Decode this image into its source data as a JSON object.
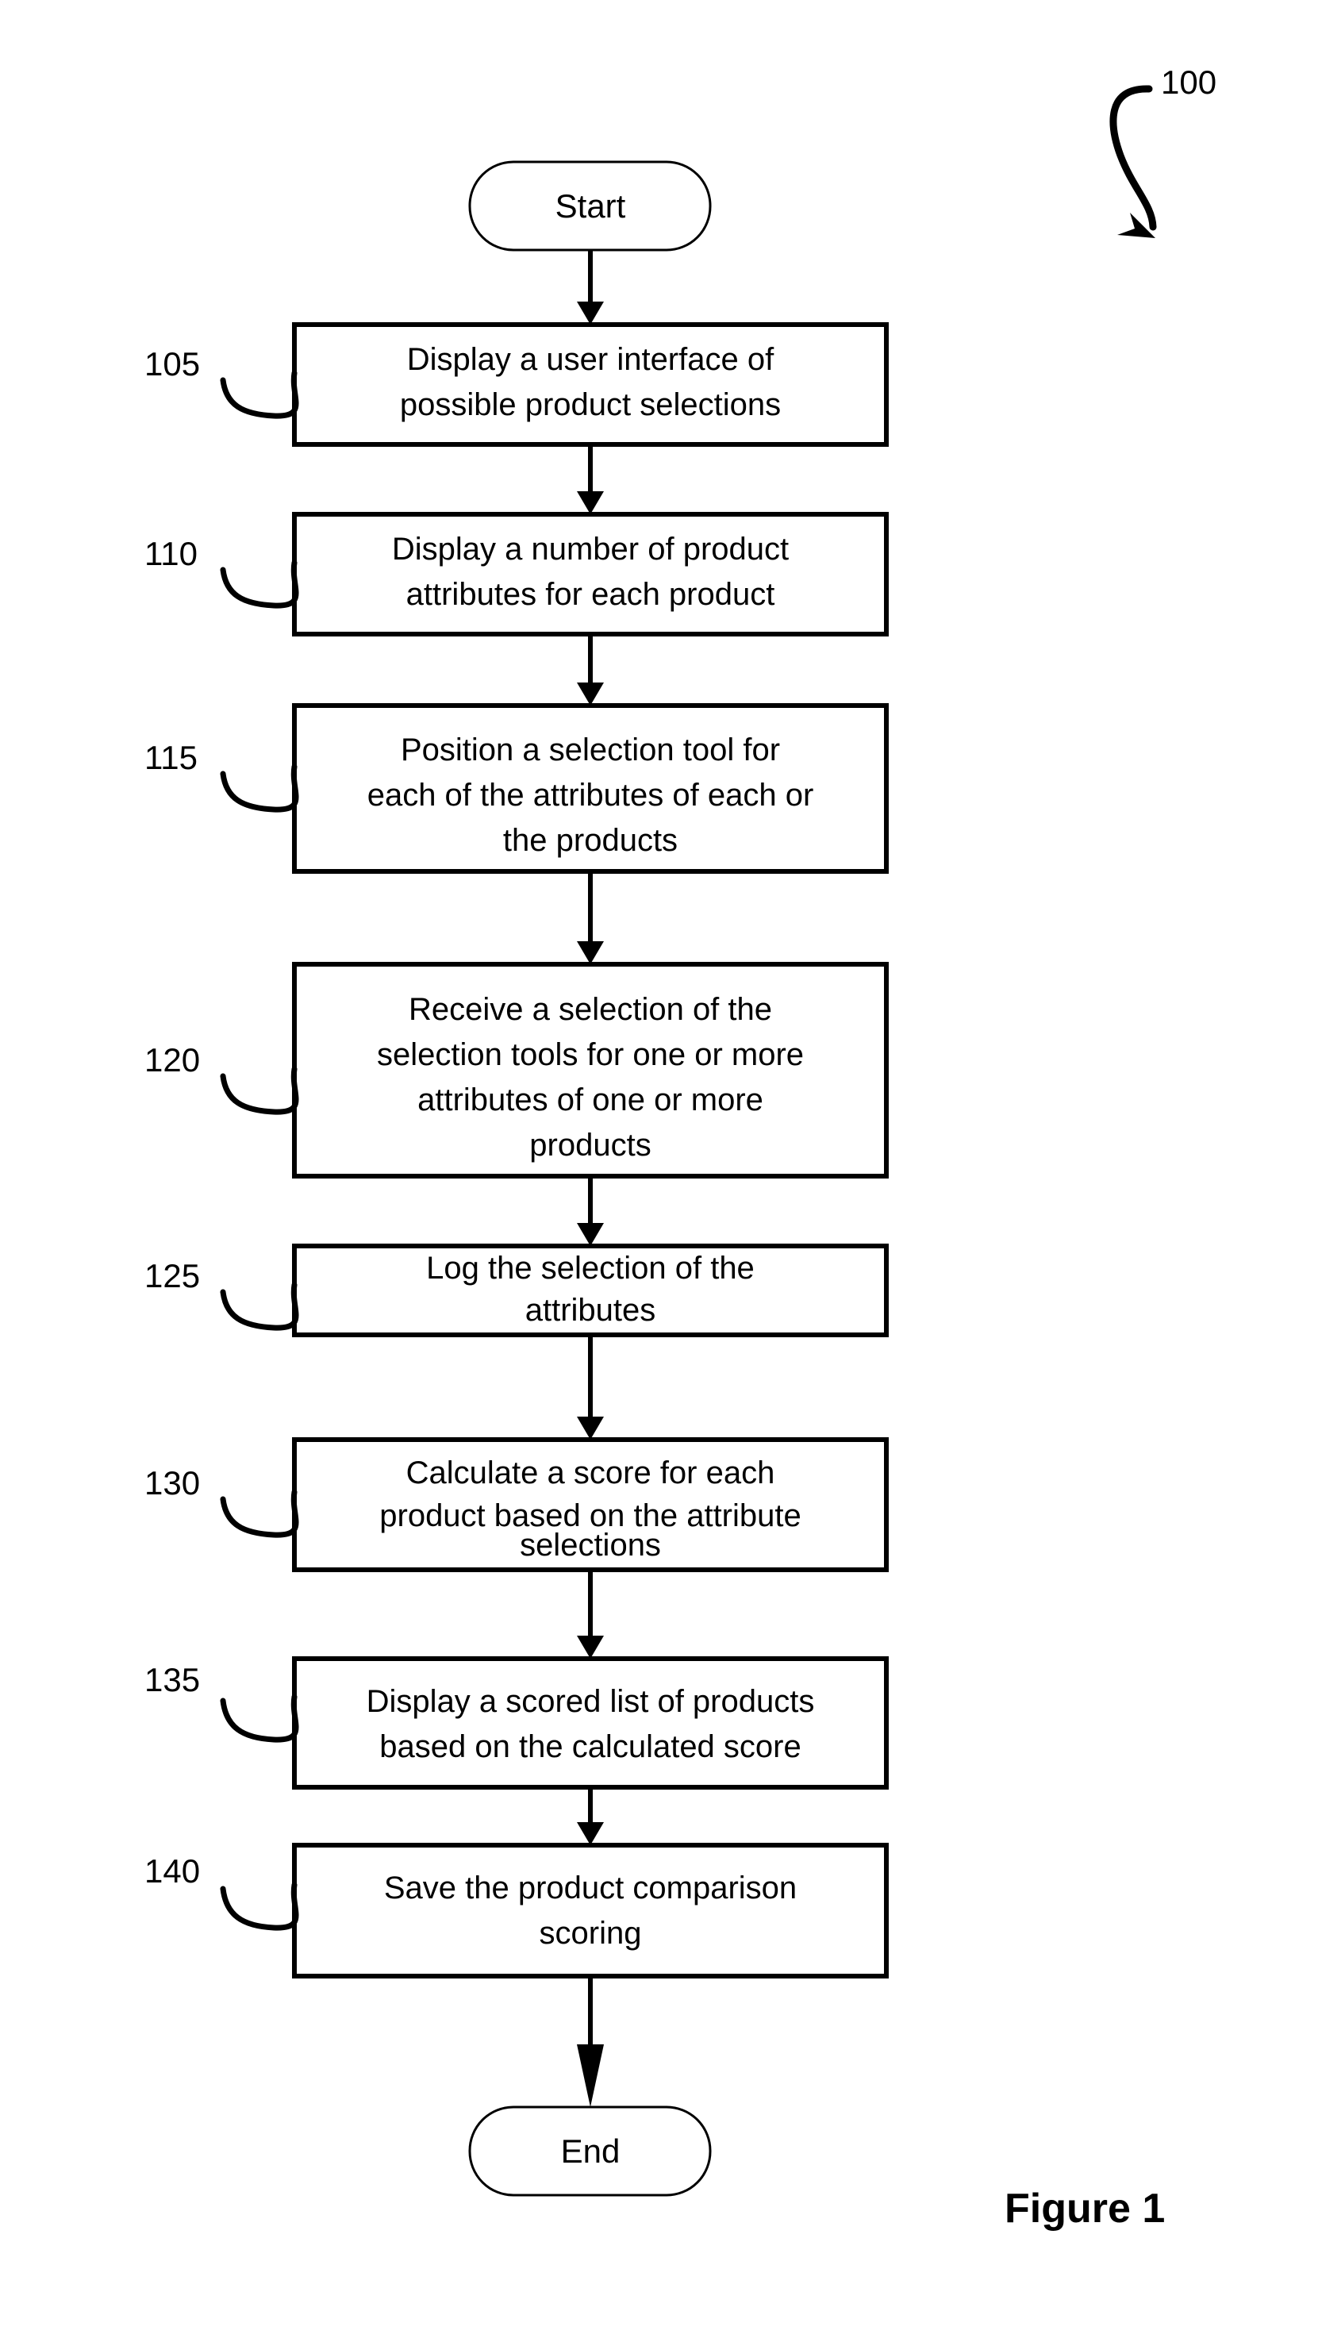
{
  "figure": {
    "caption": "Figure 1",
    "reference_numeral": "100"
  },
  "terminals": {
    "start": {
      "label": "Start",
      "ref": ""
    },
    "end": {
      "label": "End",
      "ref": ""
    }
  },
  "steps": [
    {
      "ref": "105",
      "lines": [
        "Display a user interface of",
        "possible product selections"
      ],
      "text": "Display a user interface of possible product selections"
    },
    {
      "ref": "110",
      "lines": [
        "Display a number of product",
        "attributes for each product"
      ],
      "text": "Display a number of product attributes for each product"
    },
    {
      "ref": "115",
      "lines": [
        "Position a selection tool for",
        "each of the attributes of each or",
        "the products"
      ],
      "text": "Position a selection tool for each of the attributes of each or the products"
    },
    {
      "ref": "120",
      "lines": [
        "Receive a selection of the",
        "selection tools for one or more",
        "attributes of one or more",
        "products"
      ],
      "text": "Receive a selection of the selection tools for one or more attributes of one or more products"
    },
    {
      "ref": "125",
      "lines": [
        "Log the selection of the",
        "attributes"
      ],
      "text": "Log the selection of the attributes"
    },
    {
      "ref": "130",
      "lines": [
        "Calculate a score for each",
        "product based on the attribute",
        "selections"
      ],
      "text": "Calculate a score for each product based on the attribute selections"
    },
    {
      "ref": "135",
      "lines": [
        "Display a scored list of products",
        "based on the calculated score"
      ],
      "text": "Display a scored list of products based on the calculated score"
    },
    {
      "ref": "140",
      "lines": [
        "Save the product comparison",
        "scoring"
      ],
      "text": "Save the product comparison scoring"
    }
  ],
  "colors": {
    "stroke": "#000000",
    "fill": "#ffffff",
    "text": "#000000"
  }
}
